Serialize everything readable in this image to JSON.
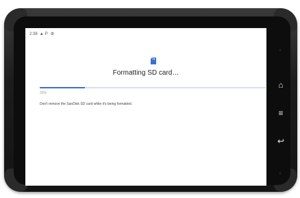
{
  "status_bar": {
    "time": "2:38",
    "icons": [
      "triangle-icon",
      "p-icon",
      "gear-icon"
    ]
  },
  "dialog": {
    "icon": "sd-card-icon",
    "title": "Formatting SD card…",
    "progress_percent": 20,
    "percent_label": "20%",
    "message": "Don't remove the SanDisk SD card while it's being formatted."
  },
  "device_buttons": {
    "home": "home-icon",
    "menu": "menu-icon",
    "back": "back-icon"
  },
  "colors": {
    "accent": "#3b6fd4",
    "track": "#d5dff0",
    "bezel": "#141414"
  }
}
